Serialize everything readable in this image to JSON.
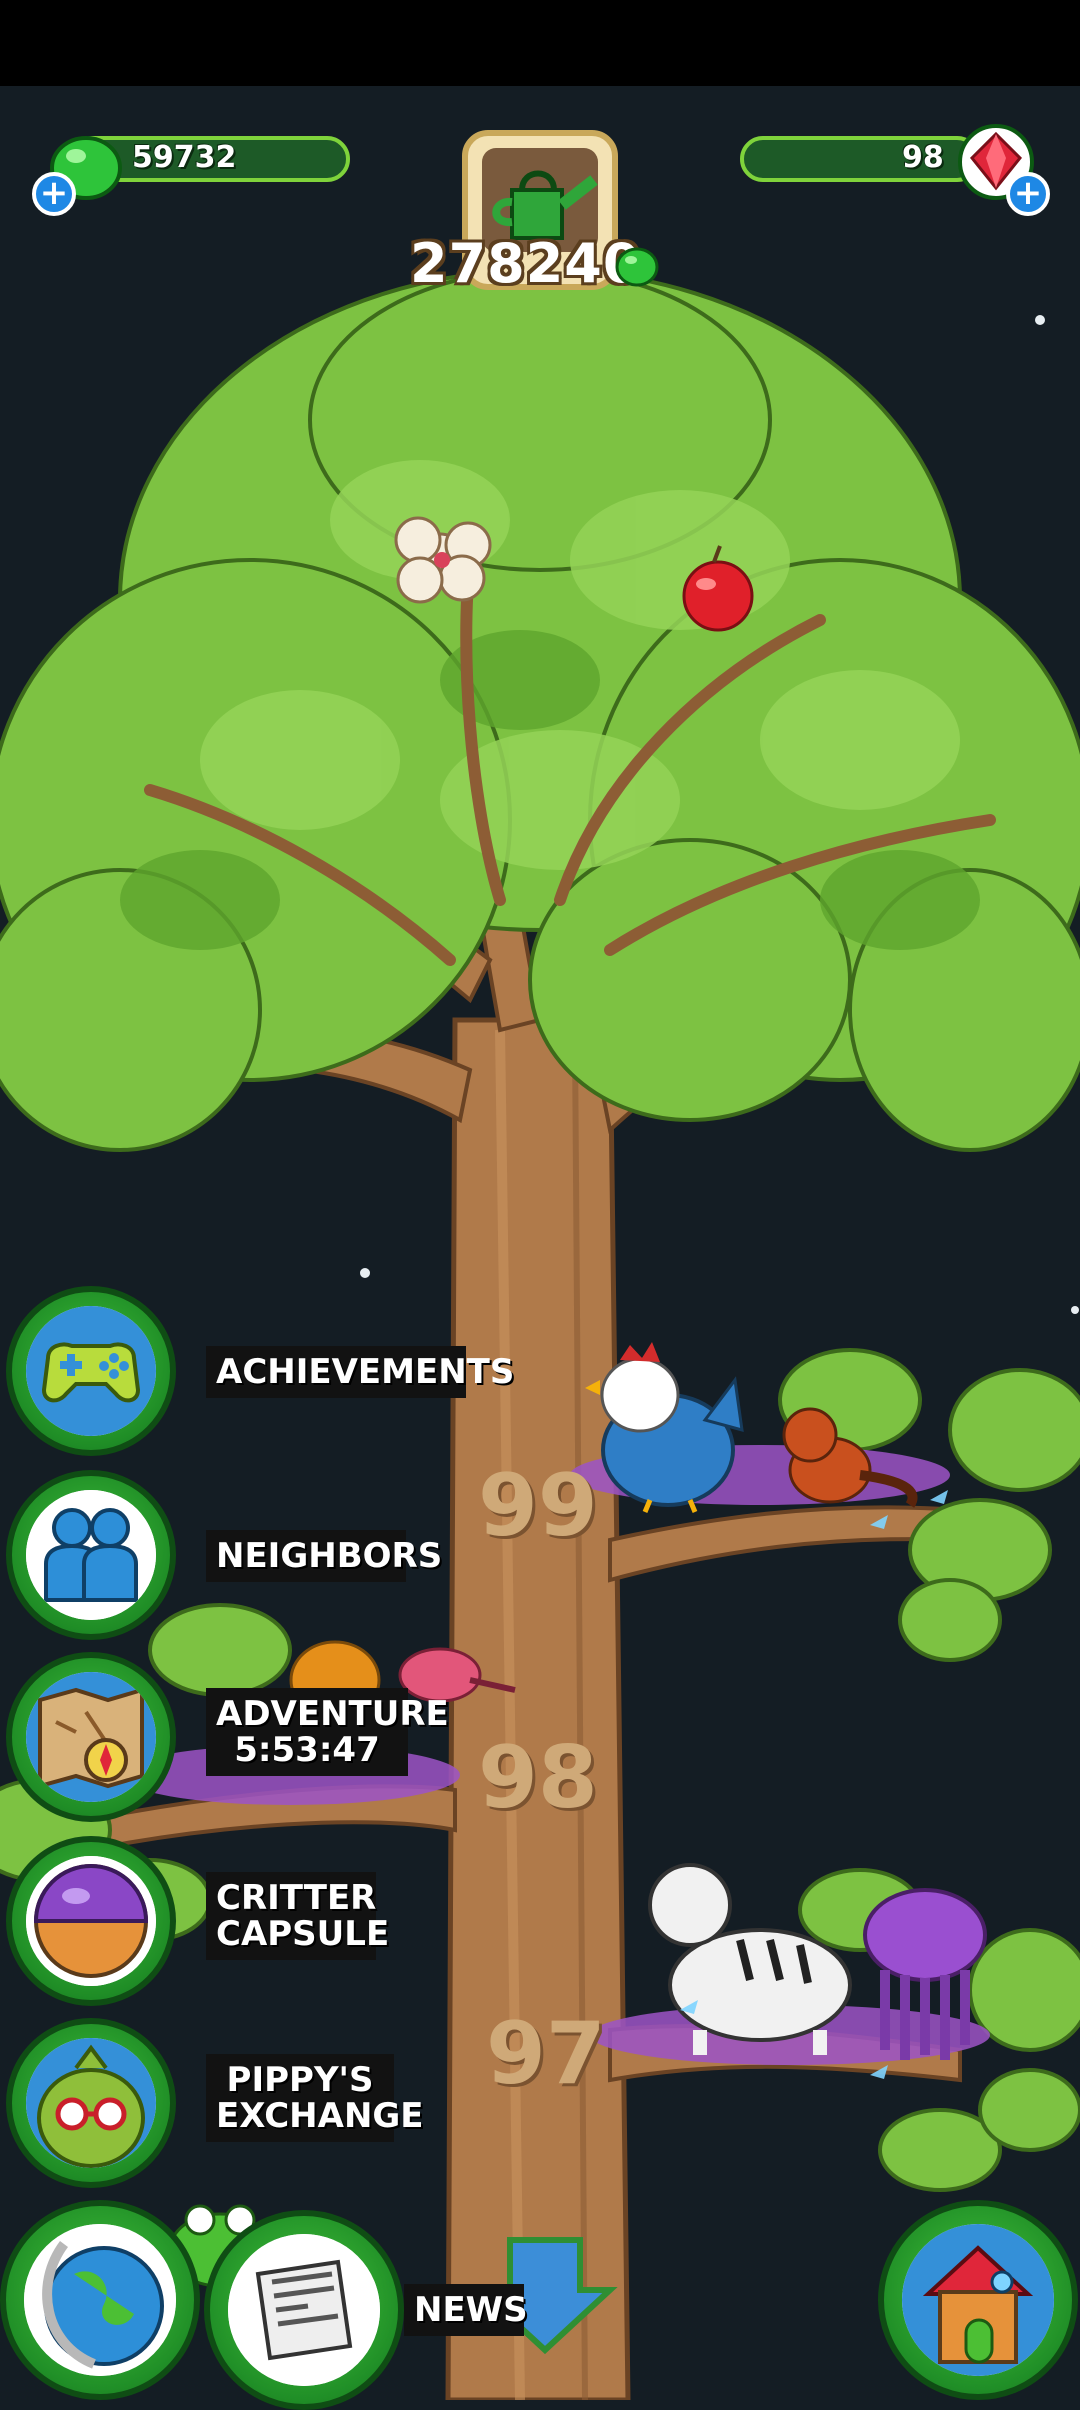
{
  "hud": {
    "left_currency": "59732",
    "right_currency": "98",
    "water_counter": "278240"
  },
  "menu": [
    {
      "label": "ACHIEVEMENTS"
    },
    {
      "label": "NEIGHBORS"
    },
    {
      "label": "ADVENTURE\n5:53:47"
    },
    {
      "label": "CRITTER\nCAPSULE"
    },
    {
      "label": "PIPPY'S\nEXCHANGE"
    }
  ],
  "bottom": {
    "news_label": "NEWS"
  },
  "tree_levels": [
    "99",
    "98",
    "97"
  ],
  "icons": {
    "green_gem": "gumdrop-icon",
    "red_gem": "ruby-icon",
    "watering_can": "watering-can-icon"
  },
  "colors": {
    "background": "#141d24",
    "leaf": "#7dc242",
    "trunk": "#b07a4a",
    "menu_green": "#1f8d26"
  }
}
